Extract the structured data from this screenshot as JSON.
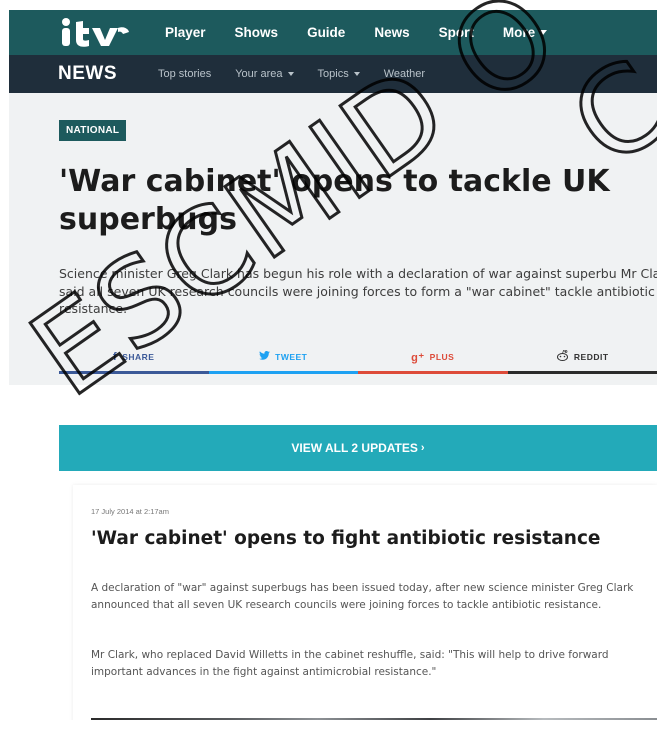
{
  "topnav": {
    "items": [
      "Player",
      "Shows",
      "Guide",
      "News",
      "Sport",
      "More"
    ]
  },
  "subnav": {
    "section": "NEWS",
    "items": [
      "Top stories",
      "Your area",
      "Topics",
      "Weather"
    ]
  },
  "article": {
    "badge": "NATIONAL",
    "headline": "'War cabinet' opens to tackle UK superbugs",
    "standfirst": "Science minister Greg Clark has begun his role with a declaration of war against superbu Mr Clark said all seven UK research councils were joining forces to form a \"war cabinet\" tackle antibiotic resistance."
  },
  "share": {
    "facebook": "SHARE",
    "twitter": "TWEET",
    "google": "PLUS",
    "reddit": "REDDIT"
  },
  "updates": {
    "button_label": "VIEW ALL 2 UPDATES",
    "entry": {
      "date": "17 July 2014 at 2:17am",
      "title": "'War cabinet' opens to fight antibiotic resistance",
      "para1": "A declaration of \"war\" against superbugs has been issued today, after new science minister Greg Clark announced that all seven UK research councils were joining forces to tackle antibiotic resistance.",
      "para2": "Mr Clark, who replaced David Willetts in the cabinet reshuffle, said: \"This will help to drive forward important advances in the fight against antimicrobial resistance.\""
    }
  },
  "watermark": {
    "text": "ESCMID O"
  },
  "colors": {
    "brand_teal": "#1d5a5d",
    "subnav_navy": "#1f2e3b",
    "updates_cyan": "#23aab9",
    "facebook": "#3b5998",
    "twitter": "#1da1f2",
    "google": "#dd4b39",
    "reddit": "#2b2b2b"
  }
}
